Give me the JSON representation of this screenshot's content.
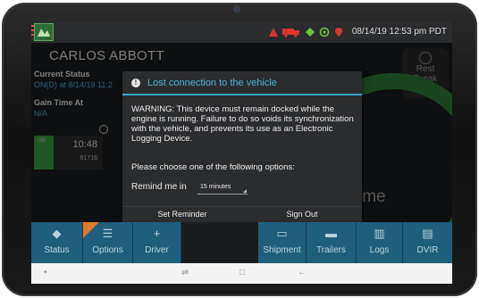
{
  "status_bar": {
    "datetime": "08/14/19 12:53 pm PDT",
    "icons": [
      "alert-triangle-icon",
      "truck-icon",
      "diamond-icon",
      "target-icon",
      "location-pin-icon"
    ]
  },
  "driver": {
    "name": "CARLOS ABBOTT"
  },
  "rest_break": {
    "line1": "Rest",
    "line2": "Break"
  },
  "left_panel": {
    "current_status_label": "Current Status",
    "current_status_value": "ON(D) at 8/14/19 11:2",
    "gain_time_label": "Gain Time At",
    "gain_time_value": "N/A",
    "gauge_label": "ON",
    "gauge_time": "10:48",
    "gauge_sub": "61716"
  },
  "main_area": {
    "time_word": "ime"
  },
  "dialog": {
    "title": "Lost connection to the vehicle",
    "warning": "WARNING: This device must remain docked while the engine is running. Failure to do so voids its synchronization with the vehicle, and prevents its use as an Electronic Logging Device.",
    "choose_text": "Please choose one of the following options:",
    "remind_label": "Remind me in",
    "remind_value": "15 minutes",
    "set_reminder_label": "Set Reminder",
    "sign_out_label": "Sign Out"
  },
  "toolbar": {
    "items": [
      {
        "label": "Status",
        "icon": "diamond-icon"
      },
      {
        "label": "Options",
        "icon": "list-icon"
      },
      {
        "label": "Driver",
        "icon": "plus-icon"
      },
      {
        "label": "Shipment",
        "icon": "calendar-icon"
      },
      {
        "label": "Trailers",
        "icon": "trailer-icon"
      },
      {
        "label": "Logs",
        "icon": "book-icon"
      },
      {
        "label": "DVIR",
        "icon": "clipboard-icon"
      }
    ]
  },
  "colors": {
    "toolbar_bg": "#1f5e7d",
    "accent": "#3aa0c9",
    "status_green": "#3aa043",
    "options_flag": "#e07a2e"
  }
}
